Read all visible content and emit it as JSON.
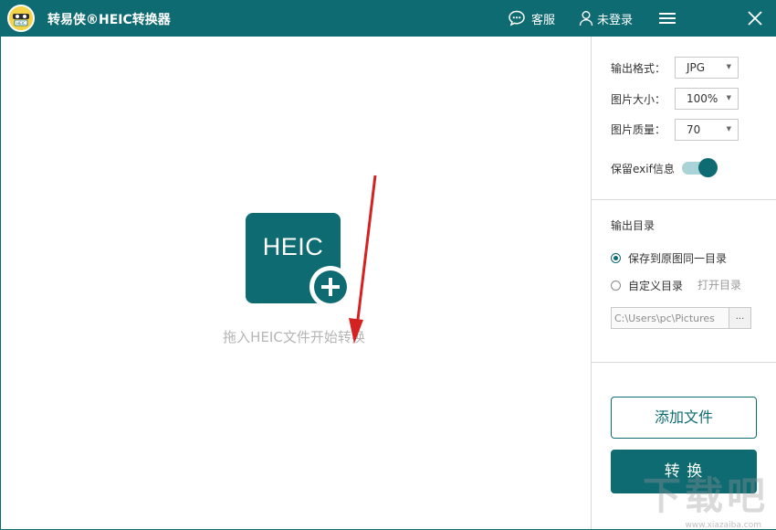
{
  "app": {
    "title": "转易侠®HEIC转换器",
    "logo_text": "HEIC"
  },
  "titlebar": {
    "service_label": "客服",
    "login_label": "未登录"
  },
  "dropzone": {
    "tile_text": "HEIC",
    "hint": "拖入HEIC文件开始转换"
  },
  "settings": {
    "format_label": "输出格式：",
    "format_value": "JPG",
    "size_label": "图片大小：",
    "size_value": "100%",
    "quality_label": "图片质量：",
    "quality_value": "70",
    "exif_label": "保留exif信息",
    "exif_enabled": true
  },
  "output": {
    "title": "输出目录",
    "option_same": "保存到原图同一目录",
    "option_custom": "自定义目录",
    "open_dir": "打开目录",
    "path": "C:\\Users\\pc\\Pictures",
    "browse_label": "...",
    "selected": "same"
  },
  "actions": {
    "add_files": "添加文件",
    "convert": "转 换"
  },
  "watermark": {
    "text": "下载吧",
    "url": "www.xiazaiba.com"
  },
  "colors": {
    "primary": "#0e6b72",
    "arrow": "#d42222"
  }
}
